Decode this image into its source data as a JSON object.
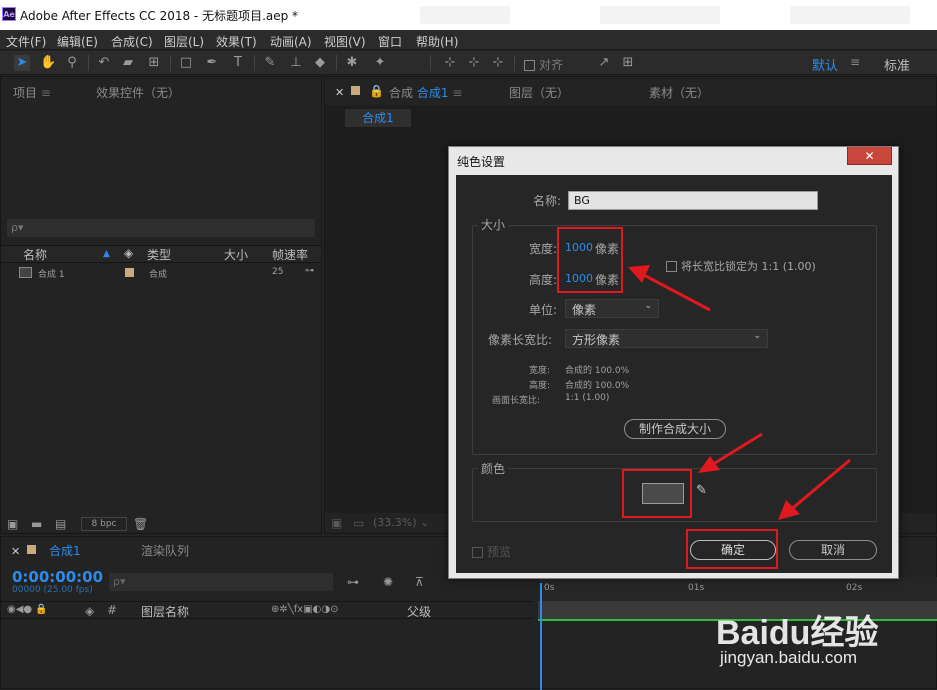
{
  "window": {
    "title": "Adobe After Effects CC 2018 - 无标题项目.aep *",
    "app_icon": "Ae"
  },
  "menu": [
    "文件(F)",
    "编辑(E)",
    "合成(C)",
    "图层(L)",
    "效果(T)",
    "动画(A)",
    "视图(V)",
    "窗口",
    "帮助(H)"
  ],
  "toolbar": {
    "align_label": "对齐",
    "workspace_default": "默认",
    "workspace_standard": "标准",
    "workspace_menu_icon": "≡"
  },
  "project_panel": {
    "tab_project": "项目",
    "tab_effects": "效果控件（无）",
    "search_placeholder": "ρ▾",
    "columns": {
      "name": "名称",
      "type": "类型",
      "size": "大小",
      "fps": "帧速率"
    },
    "row": {
      "name": "合成 1",
      "type": "合成",
      "fps": "25"
    },
    "bpc": "8 bpc"
  },
  "comp_panel": {
    "tab_comp": "合成",
    "comp_name": "合成1",
    "tab_layer": "图层（无）",
    "tab_footage": "素材（无）",
    "subtab": "合成1",
    "zoom": "(33.3%)"
  },
  "timeline": {
    "tab": "合成1",
    "render_queue": "渲染队列",
    "timecode": "0:00:00:00",
    "frame_info": "00000 (25.00 fps)",
    "layer_name_header": "图层名称",
    "parent_header": "父级",
    "hash_header": "#",
    "ruler": [
      "0s",
      "01s",
      "02s"
    ]
  },
  "dialog": {
    "title": "纯色设置",
    "close": "✕",
    "name_label": "名称:",
    "name_value": "BG",
    "size_group": "大小",
    "width_label": "宽度:",
    "width_value": "1000",
    "width_unit": "像素",
    "height_label": "高度:",
    "height_value": "1000",
    "height_unit": "像素",
    "lock_ratio": "将长宽比锁定为 1:1 (1.00)",
    "units_label": "单位:",
    "units_value": "像素",
    "par_label": "像素长宽比:",
    "par_value": "方形像素",
    "info_width_label": "宽度:",
    "info_width_value": "合成的 100.0%",
    "info_height_label": "高度:",
    "info_height_value": "合成的 100.0%",
    "info_frame_label": "画面长宽比:",
    "info_frame_value": "1:1 (1.00)",
    "make_comp_size": "制作合成大小",
    "color_group": "颜色",
    "swatch_color": "#4a4a4a",
    "preview": "预览",
    "ok": "确定",
    "cancel": "取消"
  },
  "watermark": {
    "logo": "Baidu经验",
    "url": "jingyan.baidu.com"
  },
  "colors": {
    "accent": "#2d8ceb",
    "annotation_red": "#e0191e",
    "comp_label": "#c8aa7e"
  }
}
